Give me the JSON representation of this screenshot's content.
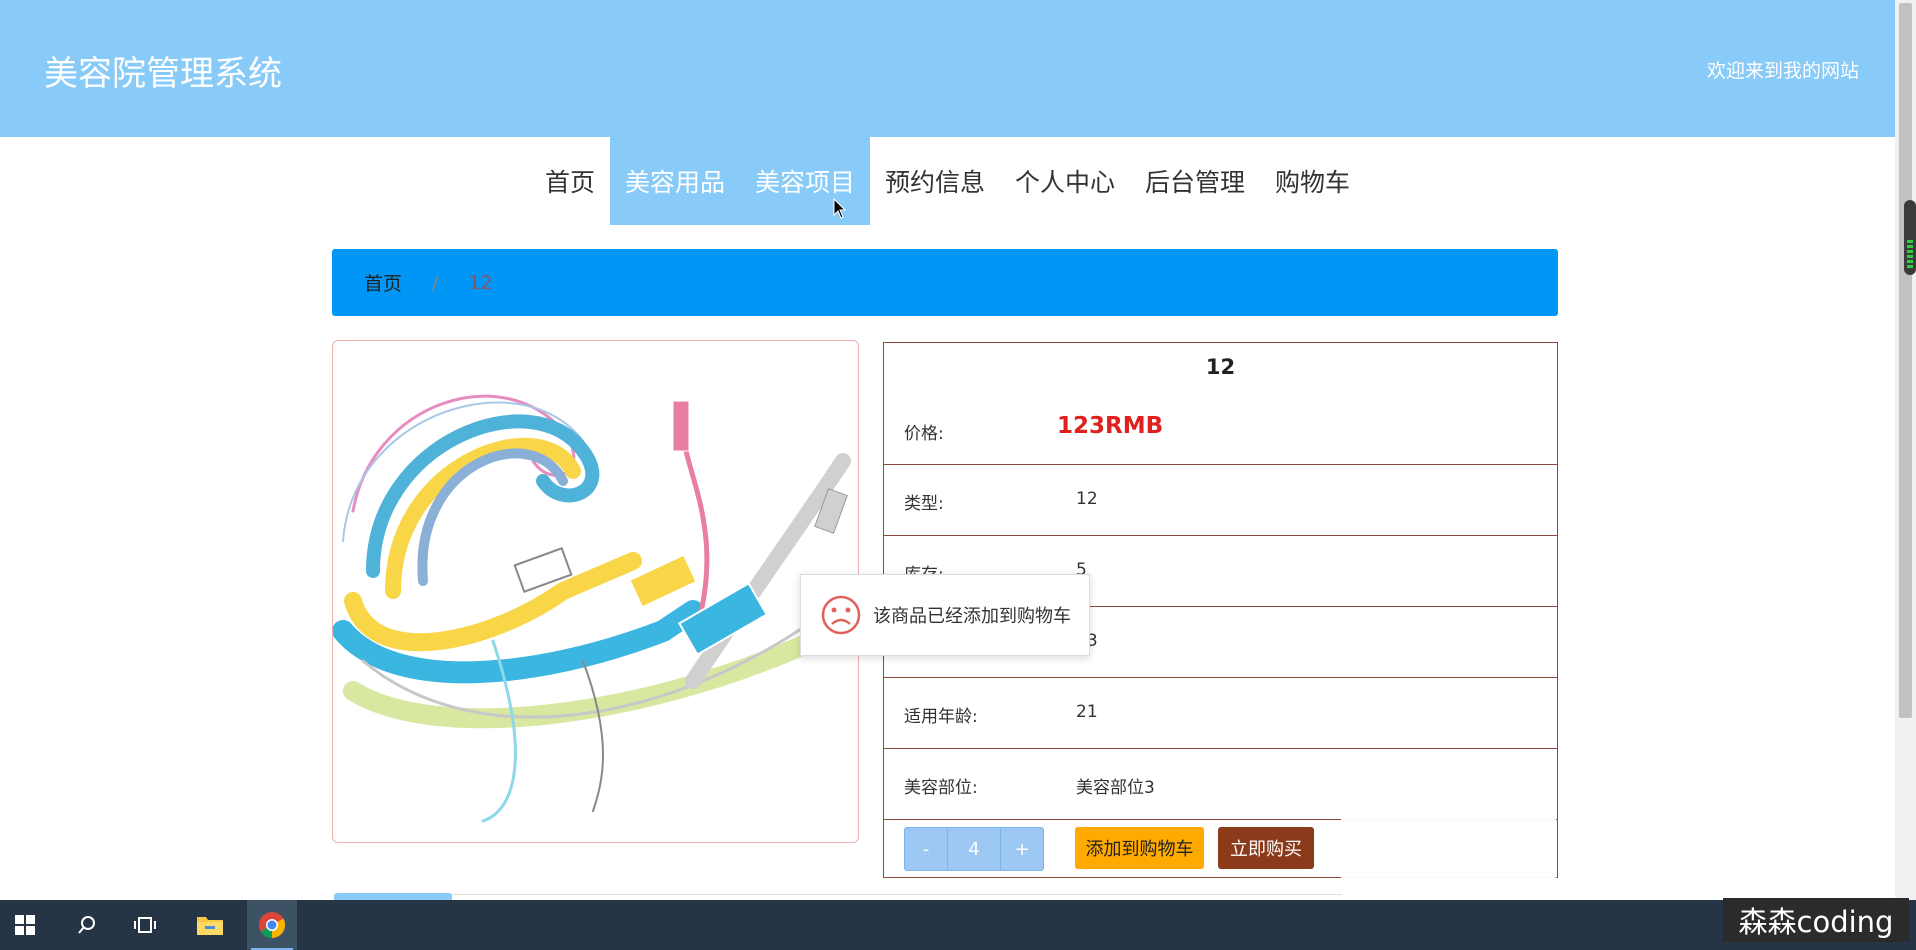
{
  "header": {
    "title": "美容院管理系统",
    "welcome": "欢迎来到我的网站"
  },
  "nav": {
    "items": [
      {
        "label": "首页"
      },
      {
        "label": "美容用品"
      },
      {
        "label": "美容项目"
      },
      {
        "label": "预约信息"
      },
      {
        "label": "个人中心"
      },
      {
        "label": "后台管理"
      },
      {
        "label": "购物车"
      }
    ]
  },
  "breadcrumb": {
    "home": "首页",
    "separator": "/",
    "current": "12"
  },
  "product": {
    "name": "12",
    "rows": [
      {
        "label": "价格:",
        "value": "123RMB"
      },
      {
        "label": "类型:",
        "value": "12"
      },
      {
        "label": "库存:",
        "value": "5"
      },
      {
        "label": "",
        "value": "23"
      },
      {
        "label": "适用年龄:",
        "value": "21"
      },
      {
        "label": "美容部位:",
        "value": "美容部位3"
      }
    ],
    "quantity": {
      "minus": "-",
      "value": "4",
      "plus": "+"
    },
    "add_to_cart": "添加到购物车",
    "buy_now": "立即购买"
  },
  "toast": {
    "message": "该商品已经添加到购物车",
    "icon": "sad-face-icon"
  },
  "watermark": "森森coding",
  "colors": {
    "header_bg": "#88CBF8",
    "breadcrumb_bg": "#0096F6",
    "price": "#E0201C",
    "cart_button": "#FFAA00",
    "buy_button": "#8B3A1A",
    "table_border": "#8B4A3A",
    "taskbar": "#253545"
  },
  "taskbar": {
    "icons": [
      "windows-start-icon",
      "search-icon",
      "task-view-icon",
      "file-explorer-icon",
      "chrome-icon"
    ]
  }
}
